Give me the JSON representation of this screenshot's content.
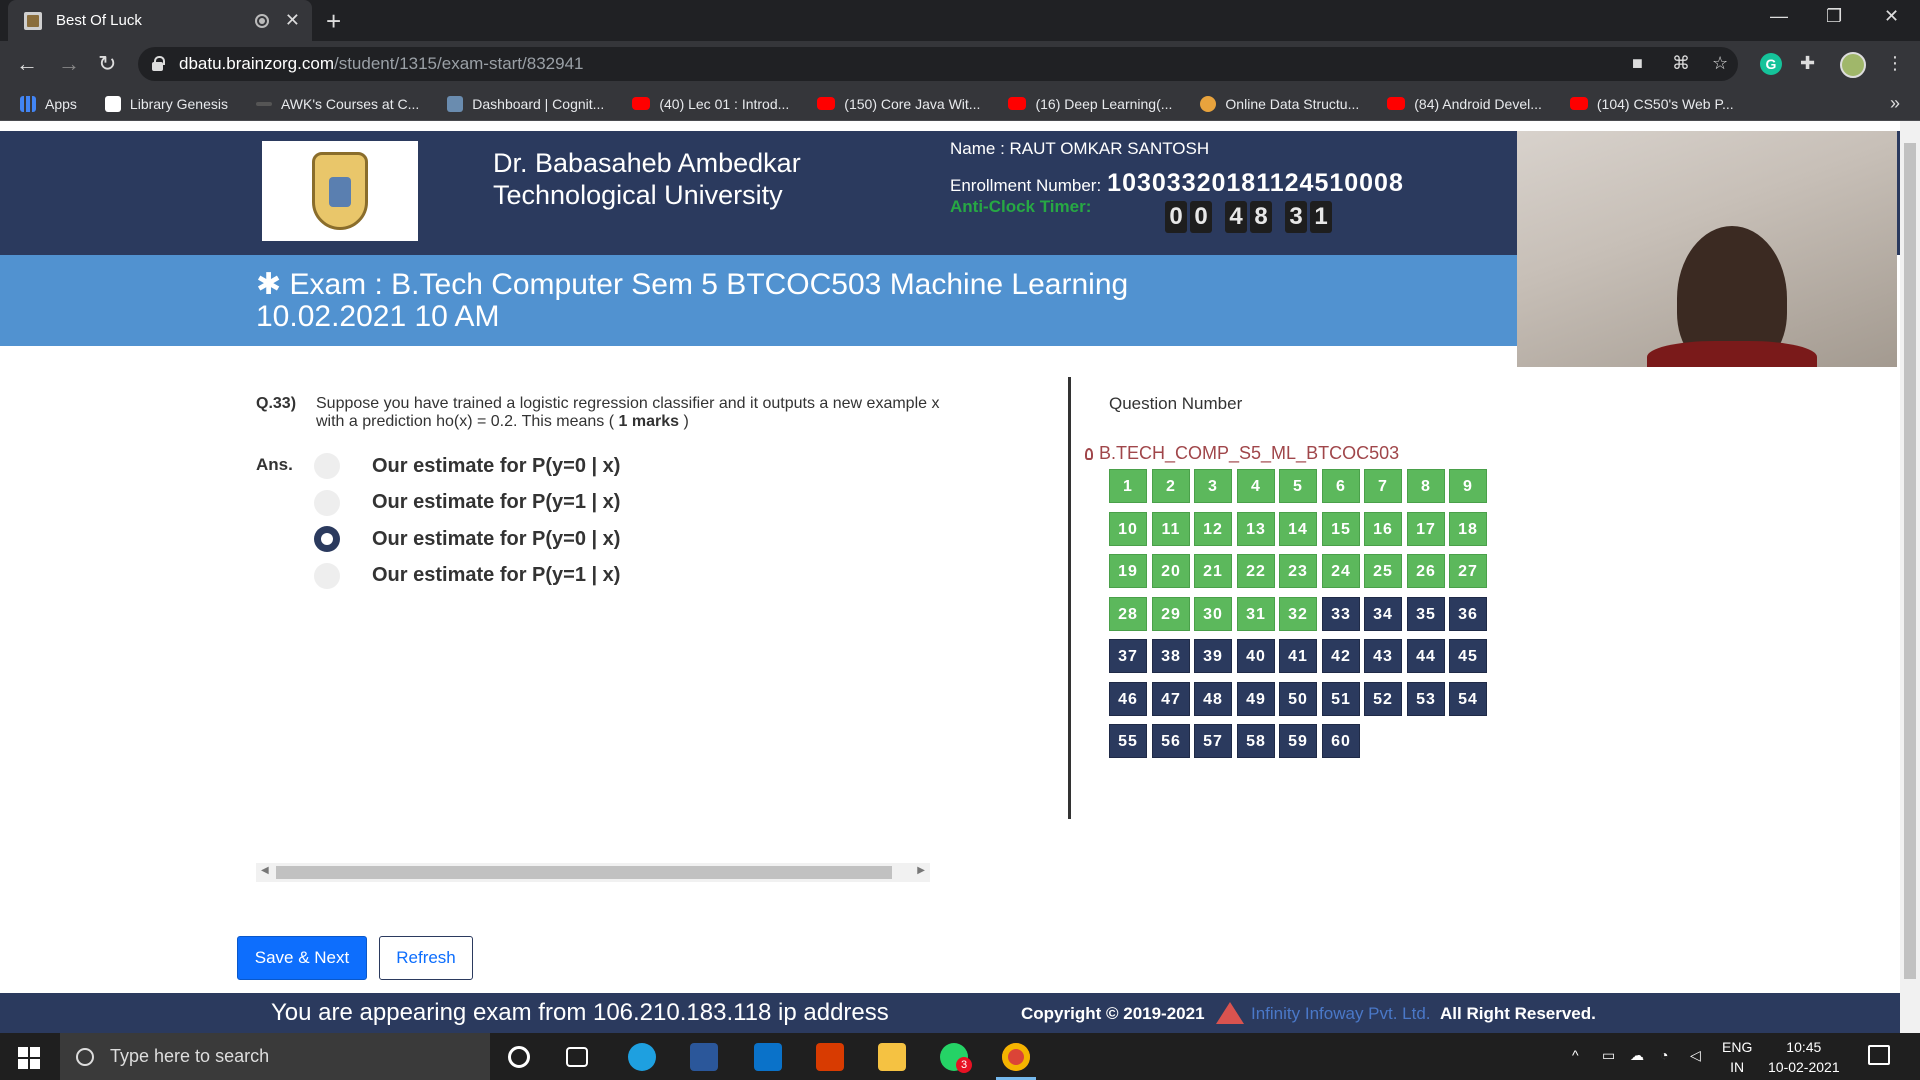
{
  "browser": {
    "tab_title": "Best Of Luck",
    "url_host": "dbatu.brainzorg.com",
    "url_path": "/student/1315/exam-start/832941",
    "bookmarks": [
      {
        "label": "Apps",
        "icon": "apps-grid-icon"
      },
      {
        "label": "Library Genesis",
        "icon": "book-icon"
      },
      {
        "label": "AWK's Courses at C...",
        "icon": "dash-icon"
      },
      {
        "label": "Dashboard | Cognit...",
        "icon": "cognitive-icon"
      },
      {
        "label": "(40) Lec 01 : Introd...",
        "icon": "youtube-icon"
      },
      {
        "label": "(150) Core Java Wit...",
        "icon": "youtube-icon"
      },
      {
        "label": "(16) Deep Learning(...",
        "icon": "youtube-icon"
      },
      {
        "label": "Online Data Structu...",
        "icon": "ods-icon"
      },
      {
        "label": "(84) Android Devel...",
        "icon": "youtube-icon"
      },
      {
        "label": "(104) CS50's Web P...",
        "icon": "youtube-icon"
      }
    ],
    "more_label": "»"
  },
  "header": {
    "university_line1": "Dr. Babasaheb Ambedkar",
    "university_line2": "Technological University",
    "name_text": "Name : RAUT OMKAR SANTOSH",
    "enrollment_label": "Enrollment Number:",
    "enrollment_number": "10303320181124510008",
    "timer_label": "Anti-Clock Timer:",
    "timer_digits": [
      "0",
      "0",
      "4",
      "8",
      "3",
      "1"
    ]
  },
  "exam": {
    "title_line1": "✱ Exam : B.Tech Computer Sem 5 BTCOC503 Machine Learning",
    "title_line2": "10.02.2021 10 AM"
  },
  "question": {
    "number": "Q.33)",
    "text": "Suppose you have trained a logistic regression classifier and it outputs a new example x with a prediction ho(x) = 0.2. This means (",
    "marks": "1 marks",
    "text_end": ")",
    "ans_label": "Ans.",
    "options": [
      {
        "label": "Our estimate for P(y=0 | x)",
        "checked": false
      },
      {
        "label": "Our estimate for P(y=1 | x)",
        "checked": false
      },
      {
        "label": "Our estimate for P(y=0 | x)",
        "checked": true
      },
      {
        "label": "Our estimate for P(y=1 | x)",
        "checked": false
      }
    ]
  },
  "navigator": {
    "title": "Question Number",
    "section": "B.TECH_COMP_S5_ML_BTCOC503",
    "answered_count": 32,
    "total": 60
  },
  "buttons": {
    "save_next": "Save & Next",
    "refresh": "Refresh"
  },
  "footer": {
    "ip_text": "You are appearing exam from 106.210.183.118 ip address",
    "copyright": "Copyright © 2019-2021",
    "company": "Infinity Infoway Pvt. Ltd.",
    "rights": "All Right Reserved."
  },
  "taskbar": {
    "search_placeholder": "Type here to search",
    "whatsapp_badge": "3",
    "lang_line1": "ENG",
    "lang_line2": "IN",
    "time": "10:45",
    "date": "10-02-2021"
  }
}
